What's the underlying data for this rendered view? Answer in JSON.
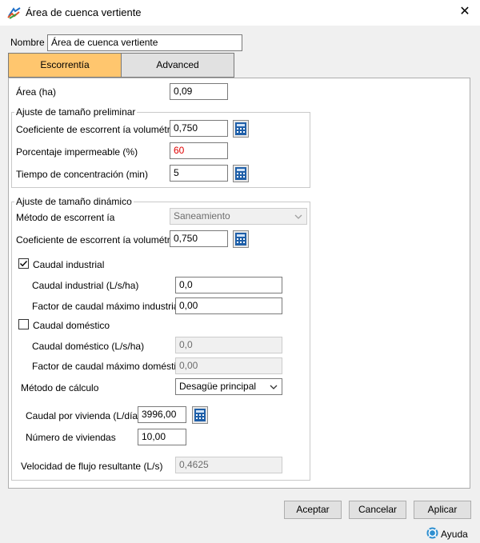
{
  "window": {
    "title": "Área de cuenca vertiente",
    "close": "✕"
  },
  "name_field": {
    "label": "Nombre",
    "value": "Área de cuenca vertiente"
  },
  "tabs": [
    {
      "label": "Escorrentía",
      "active": true
    },
    {
      "label": "Advanced",
      "active": false
    }
  ],
  "area": {
    "label": "Área (ha)",
    "value": "0,09"
  },
  "preliminary": {
    "title": "Ajuste de tamaño preliminar",
    "runoff_coef": {
      "label": "Coeficiente de escorrent ía volumétrica",
      "value": "0,750"
    },
    "impervious": {
      "label": "Porcentaje impermeable (%)",
      "value": "60"
    },
    "concentration_time": {
      "label": "Tiempo de concentración (min)",
      "value": "5"
    }
  },
  "dynamic": {
    "title": "Ajuste de tamaño dinámico",
    "runoff_method": {
      "label": "Método de escorrent ía",
      "value": "Saneamiento"
    },
    "runoff_coef": {
      "label": "Coeficiente de escorrent ía volumétrica",
      "value": "0,750"
    },
    "industrial": {
      "label": "Caudal industrial",
      "checked": true,
      "flow": {
        "label": "Caudal industrial (L/s/ha)",
        "value": "0,0"
      },
      "peak_factor": {
        "label": "Factor de caudal máximo industrial",
        "value": "0,00"
      }
    },
    "domestic": {
      "label": "Caudal doméstico",
      "checked": false,
      "flow": {
        "label": "Caudal doméstico (L/s/ha)",
        "value": "0,0"
      },
      "peak_factor": {
        "label": "Factor de caudal máximo doméstico",
        "value": "0,00"
      }
    },
    "calc_method": {
      "label": "Método de cálculo",
      "value": "Desagüe principal"
    },
    "per_dwelling": {
      "label": "Caudal por vivienda (L/día)",
      "value": "3996,00"
    },
    "dwellings": {
      "label": "Número de viviendas",
      "value": "10,00"
    },
    "result_flow": {
      "label": "Velocidad de flujo resultante (L/s)",
      "value": "0,4625"
    }
  },
  "buttons": {
    "accept": "Aceptar",
    "cancel": "Cancelar",
    "apply": "Aplicar",
    "help": "Ayuda"
  },
  "colors": {
    "active_tab": "#ffc66e",
    "invalid_text": "#e00000",
    "calc_icon": "#1f5fa8"
  }
}
